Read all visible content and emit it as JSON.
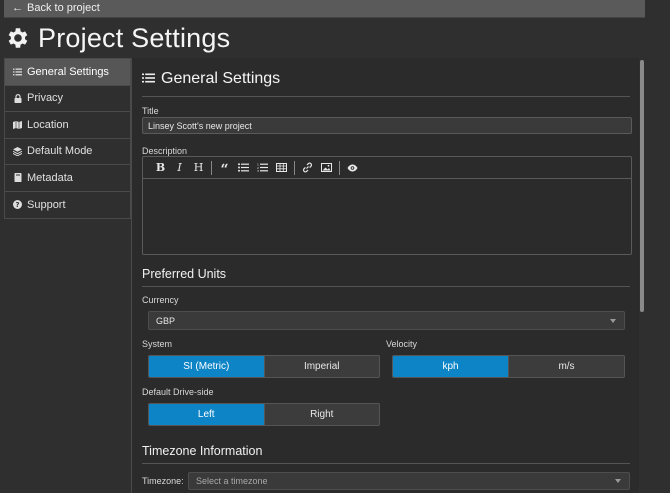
{
  "topbar": {
    "back_label": "Back to project"
  },
  "header": {
    "title": "Project Settings"
  },
  "sidebar": {
    "items": [
      {
        "label": "General Settings",
        "icon": "list-icon",
        "active": true
      },
      {
        "label": "Privacy",
        "icon": "lock-icon"
      },
      {
        "label": "Location",
        "icon": "map-icon"
      },
      {
        "label": "Default Mode",
        "icon": "layers-icon"
      },
      {
        "label": "Metadata",
        "icon": "book-icon"
      },
      {
        "label": "Support",
        "icon": "question-icon"
      }
    ]
  },
  "general": {
    "heading": "General Settings",
    "title_label": "Title",
    "title_value": "Linsey Scott's new project",
    "description_label": "Description",
    "toolbar": [
      "bold-icon",
      "italic-icon",
      "heading-icon",
      "quote-icon",
      "bullet-list-icon",
      "numbered-list-icon",
      "table-icon",
      "link-icon",
      "image-icon",
      "preview-icon"
    ]
  },
  "units": {
    "heading": "Preferred Units",
    "currency_label": "Currency",
    "currency_value": "GBP",
    "system_label": "System",
    "system_options": [
      "SI (Metric)",
      "Imperial"
    ],
    "velocity_label": "Velocity",
    "velocity_options": [
      "kph",
      "m/s"
    ],
    "drive_label": "Default Drive-side",
    "drive_options": [
      "Left",
      "Right"
    ]
  },
  "timezone": {
    "heading": "Timezone Information",
    "label": "Timezone:",
    "placeholder": "Select a timezone"
  },
  "colors": {
    "accent": "#0d84c6",
    "background": "#2f2f2f"
  }
}
